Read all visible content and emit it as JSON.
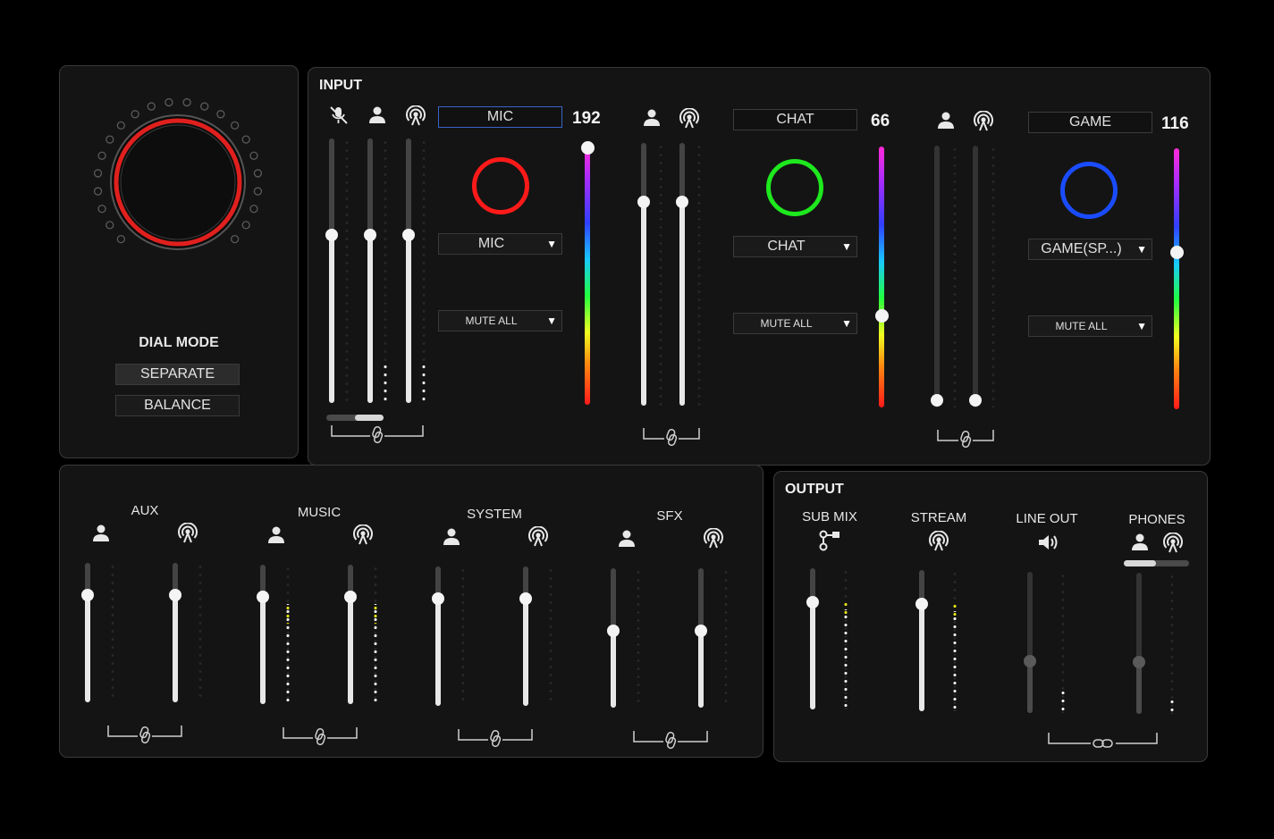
{
  "dial": {
    "mode_label": "DIAL MODE",
    "buttons": [
      "SEPARATE",
      "BALANCE"
    ],
    "selected": "SEPARATE",
    "ring_color": "#e0201e"
  },
  "input": {
    "title": "INPUT",
    "channels": [
      {
        "name": "MIC",
        "value": "192",
        "ring_color": "#ff1a1a",
        "source": "MIC",
        "mute": "MUTE ALL",
        "level": 0.98,
        "name_selected": true
      },
      {
        "name": "CHAT",
        "value": "66",
        "ring_color": "#1ee81e",
        "source": "CHAT",
        "mute": "MUTE ALL",
        "level": 0.36
      },
      {
        "name": "GAME",
        "value": "116",
        "ring_color": "#1a4cff",
        "source": "GAME(SP...)",
        "mute": "MUTE ALL",
        "level": 0.61
      }
    ]
  },
  "mix": {
    "channels": [
      "AUX",
      "MUSIC",
      "SYSTEM",
      "SFX"
    ]
  },
  "output": {
    "title": "OUTPUT",
    "channels": [
      "SUB MIX",
      "STREAM",
      "LINE OUT",
      "PHONES"
    ]
  },
  "colors": {
    "background": "#000000",
    "panel": "#141414",
    "meter_peak": "#e7e51a"
  },
  "icons": [
    "mic-muted-icon",
    "person-icon",
    "broadcast-icon",
    "link-icon",
    "speaker-icon",
    "submix-icon"
  ]
}
